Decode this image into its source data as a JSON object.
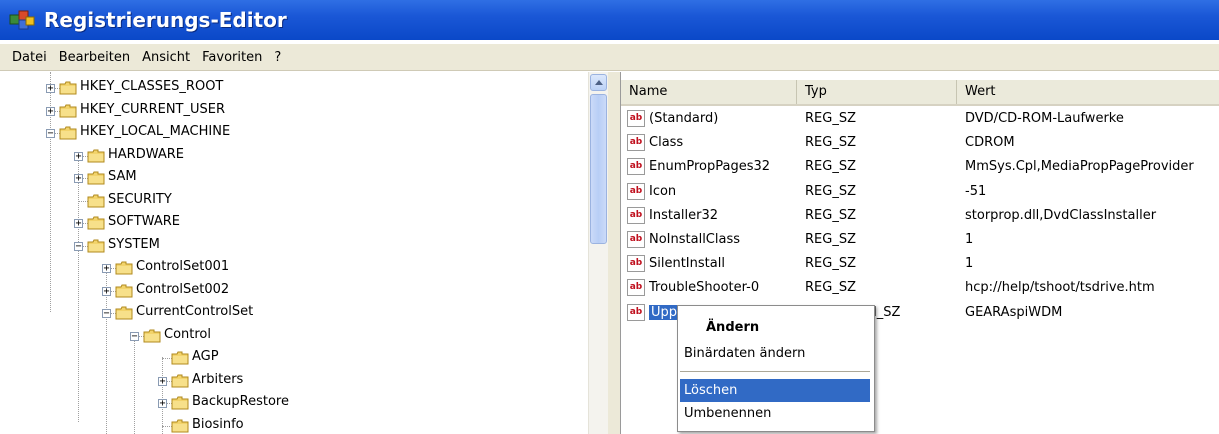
{
  "window": {
    "title": "Registrierungs-Editor"
  },
  "menu": [
    "Datei",
    "Bearbeiten",
    "Ansicht",
    "Favoriten",
    "?"
  ],
  "tree": {
    "items": [
      {
        "label": "HKEY_CLASSES_ROOT",
        "expander": "+"
      },
      {
        "label": "HKEY_CURRENT_USER",
        "expander": "+"
      },
      {
        "label": "HKEY_LOCAL_MACHINE",
        "expander": "−"
      },
      {
        "label": "HARDWARE",
        "expander": "+"
      },
      {
        "label": "SAM",
        "expander": "+"
      },
      {
        "label": "SECURITY",
        "expander": ""
      },
      {
        "label": "SOFTWARE",
        "expander": "+"
      },
      {
        "label": "SYSTEM",
        "expander": "−"
      },
      {
        "label": "ControlSet001",
        "expander": "+"
      },
      {
        "label": "ControlSet002",
        "expander": "+"
      },
      {
        "label": "CurrentControlSet",
        "expander": "−"
      },
      {
        "label": "Control",
        "expander": "−"
      },
      {
        "label": "AGP",
        "expander": ""
      },
      {
        "label": "Arbiters",
        "expander": "+"
      },
      {
        "label": "BackupRestore",
        "expander": "+"
      },
      {
        "label": "Biosinfo",
        "expander": ""
      }
    ]
  },
  "list": {
    "columns": {
      "name": "Name",
      "type": "Typ",
      "value": "Wert"
    },
    "icon_text": "ab",
    "rows": [
      {
        "name": "(Standard)",
        "type": "REG_SZ",
        "value": "DVD/CD-ROM-Laufwerke"
      },
      {
        "name": "Class",
        "type": "REG_SZ",
        "value": "CDROM"
      },
      {
        "name": "EnumPropPages32",
        "type": "REG_SZ",
        "value": "MmSys.Cpl,MediaPropPageProvider"
      },
      {
        "name": "Icon",
        "type": "REG_SZ",
        "value": "-51"
      },
      {
        "name": "Installer32",
        "type": "REG_SZ",
        "value": "storprop.dll,DvdClassInstaller"
      },
      {
        "name": "NoInstallClass",
        "type": "REG_SZ",
        "value": "1"
      },
      {
        "name": "SilentInstall",
        "type": "REG_SZ",
        "value": "1"
      },
      {
        "name": "TroubleShooter-0",
        "type": "REG_SZ",
        "value": "hcp://help/tshoot/tsdrive.htm"
      },
      {
        "name": "UpperFilters",
        "type": "REG_MULTI_SZ",
        "value": "GEARAspiWDM"
      }
    ]
  },
  "context_menu": {
    "items": [
      "Ändern",
      "Binärdaten ändern",
      "Löschen",
      "Umbenennen"
    ],
    "highlighted": "Löschen"
  },
  "colors": {
    "title_bar": "#0a48c8",
    "selection": "#316ac5",
    "menu_bg": "#ece9d8"
  }
}
